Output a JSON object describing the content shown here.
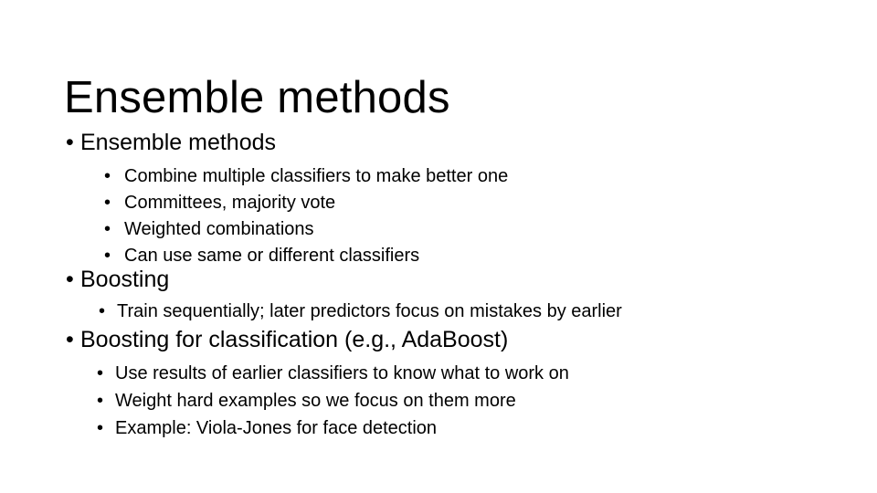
{
  "slide": {
    "title": "Ensemble methods",
    "bullet_glyph": "•",
    "background_color": "#ffffff",
    "text_color": "#000000",
    "groups": [
      {
        "id": "ensemble",
        "heading": "Ensemble methods",
        "items": [
          "Combine multiple classifiers to make better one",
          "Committees, majority vote",
          "Weighted combinations",
          "Can use same or different classifiers"
        ]
      },
      {
        "id": "boosting",
        "heading": "Boosting",
        "items": [
          "Train sequentially; later predictors focus on mistakes by earlier"
        ]
      },
      {
        "id": "boostingclass",
        "heading": "Boosting for classification (e.g., AdaBoost)",
        "items": [
          "Use results of earlier classifiers to know what to work on",
          "Weight hard examples so we focus on them more",
          "Example: Viola-Jones for face detection"
        ]
      }
    ]
  }
}
